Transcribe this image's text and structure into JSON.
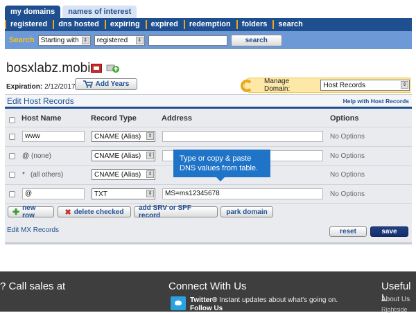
{
  "tabs": [
    {
      "label": "my domains",
      "active": true
    },
    {
      "label": "names of interest",
      "active": false
    }
  ],
  "nav": [
    "registered",
    "dns hosted",
    "expiring",
    "expired",
    "redemption",
    "folders",
    "search"
  ],
  "search": {
    "label": "Search",
    "mode": "Starting with",
    "scope": "registered",
    "query": "",
    "button": "search"
  },
  "domain": {
    "name": "bosxlabz.mobi",
    "expiration_label": "Expiration:",
    "expiration_date": "2/12/2017",
    "add_years": "Add Years",
    "manage_label": "Manage Domain:",
    "manage_value": "Host Records"
  },
  "panel": {
    "title": "Edit Host Records",
    "help": "Help with Host Records",
    "columns": [
      "Host Name",
      "Record Type",
      "Address",
      "Options"
    ],
    "rows": [
      {
        "host": "www",
        "host_hint": "",
        "type": "CNAME (Alias)",
        "address": "",
        "options": "No Options"
      },
      {
        "host": "@",
        "host_hint": "(none)",
        "type": "CNAME (Alias)",
        "address": "",
        "options": "No Options"
      },
      {
        "host": "*",
        "host_hint": "(all others)",
        "type": "CNAME (Alias)",
        "address": "",
        "options": "No Options"
      },
      {
        "host": "@",
        "host_hint": "",
        "type": "TXT",
        "address": "MS=ms12345678",
        "options": "No Options"
      }
    ],
    "tooltip_line1": "Type or copy & paste",
    "tooltip_line2": "DNS values from table.",
    "actions": [
      "new row",
      "delete checked",
      "add SRV or SPF record",
      "park domain"
    ],
    "mx_link": "Edit MX Records",
    "reset": "reset",
    "save": "save"
  },
  "footer": {
    "sales": "? Call sales at",
    "connect": "Connect With Us",
    "useful": "Useful L",
    "twitter_name": "Twitter®",
    "twitter_text": " Instant updates about what's going on.",
    "follow": "Follow Us",
    "about": "About Us",
    "cut": "Rightside"
  },
  "colors": {
    "brand_blue": "#1f4f8f",
    "search_band": "#6d9ad6",
    "accent_orange": "#e8a81c",
    "tooltip_blue": "#1f74c8",
    "footer_gray": "#3e3e3e"
  }
}
